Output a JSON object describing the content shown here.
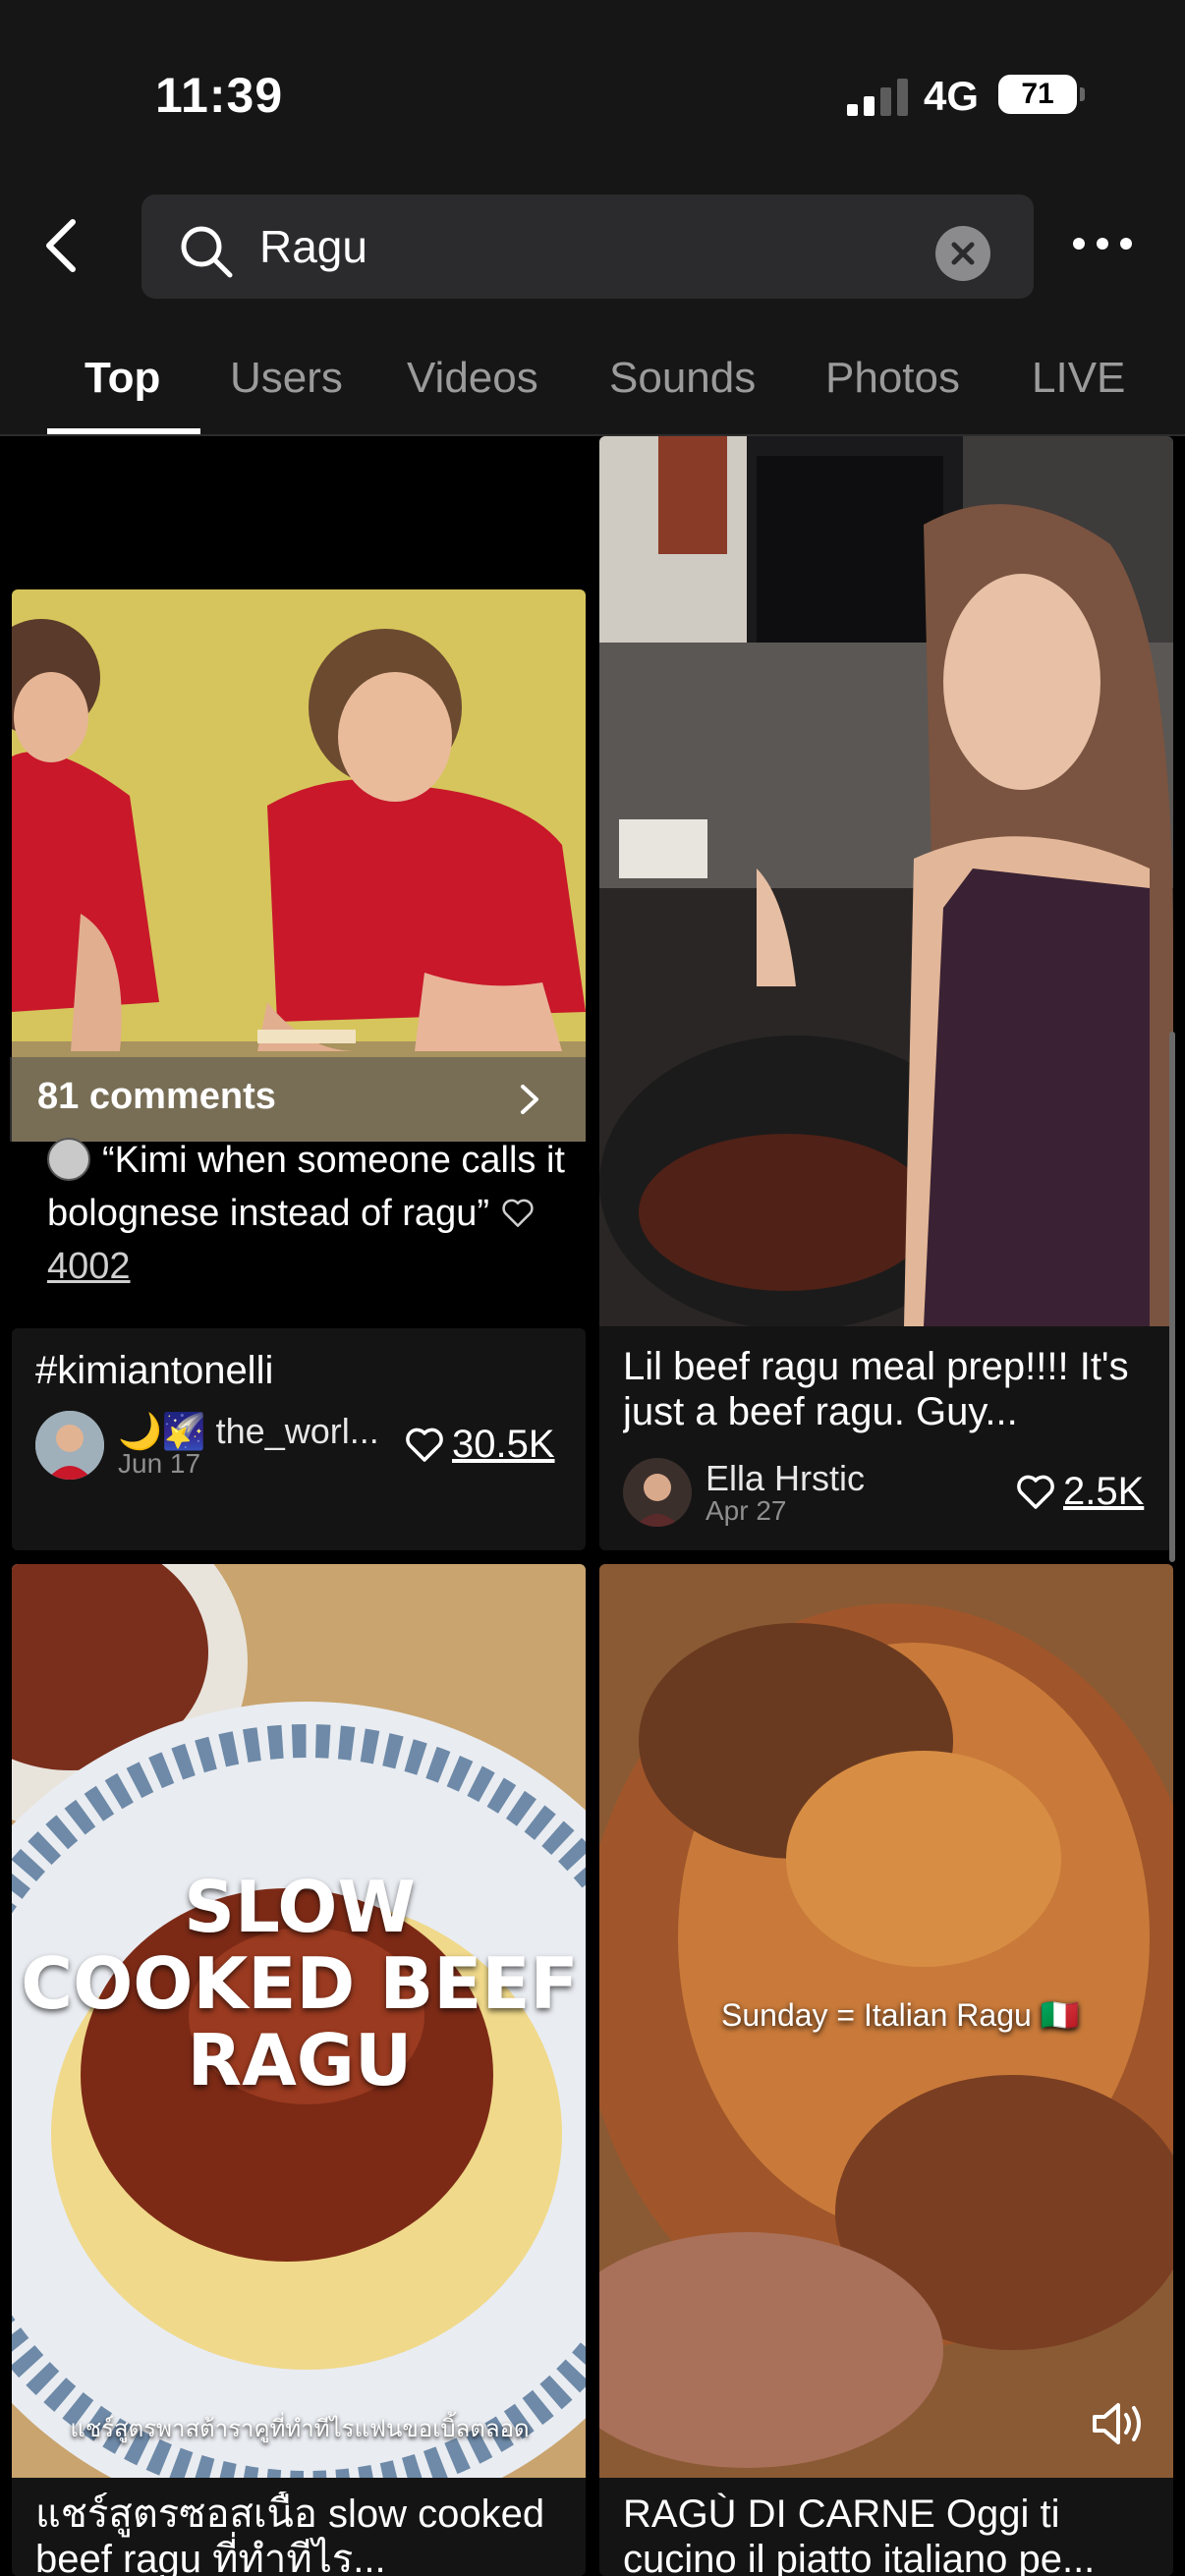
{
  "status_bar": {
    "time": "11:39",
    "network": "4G",
    "battery": "71"
  },
  "search": {
    "query": "Ragu",
    "placeholder": "Search"
  },
  "tabs": [
    "Top",
    "Users",
    "Videos",
    "Sounds",
    "Photos",
    "LIVE"
  ],
  "active_tab": "Top",
  "cards": [
    {
      "comments_label": "81 comments",
      "top_comment": "“Kimi when someone calls it bolognese instead of ragu”",
      "top_comment_likes": "4002",
      "caption": "#kimiantonelli",
      "author": "🌙🌠 the_worl...",
      "date": "Jun 17",
      "likes": "30.5K"
    },
    {
      "caption": "Lil beef ragu meal prep!!!! It's just a beef ragu.  Guy...",
      "author": "Ella Hrstic",
      "date": "Apr 27",
      "likes": "2.5K"
    },
    {
      "overlay_title": "SLOW COOKED BEEF RAGU",
      "overlay_subtitle": "แชร์สูตรพาสต้าราคูที่ทำทีไรแฟนขอเบิ้ลตลอด",
      "caption": "แชร์สูตรซอสเนื้อ slow cooked beef ragu ที่ทำทีไร..."
    },
    {
      "overlay_text": "Sunday = Italian Ragu 🇮🇹",
      "caption": "RAGÙ DI CARNE Oggi ti cucino il piatto italiano pe..."
    }
  ],
  "colors": {
    "background": "#000000",
    "header": "#161616",
    "card": "#141414",
    "search_field": "#2b2b2d",
    "inactive_tab": "#9b9b9b"
  }
}
